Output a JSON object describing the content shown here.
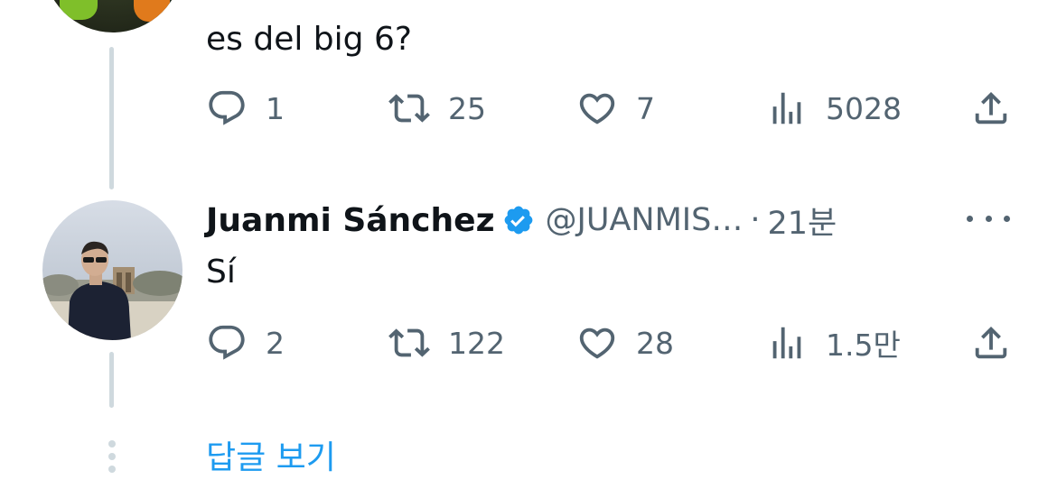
{
  "colors": {
    "text_primary": "#0f1419",
    "text_secondary": "#536471",
    "link": "#1d9bf0",
    "thread_line": "#cfd9de",
    "verified_badge": "#1d9bf0"
  },
  "tweets": [
    {
      "text": "es del big 6?",
      "actions": {
        "reply_count": "1",
        "retweet_count": "25",
        "like_count": "7",
        "view_count": "5028"
      }
    },
    {
      "display_name": "Juanmi Sánchez",
      "verified": true,
      "handle": "@JUANMIS…",
      "separator": "·",
      "time": "21분",
      "text": "Sí",
      "actions": {
        "reply_count": "2",
        "retweet_count": "122",
        "like_count": "28",
        "view_count": "1.5만"
      }
    }
  ],
  "icons": {
    "reply": "reply-icon",
    "retweet": "retweet-icon",
    "like": "heart-icon",
    "views": "views-icon",
    "share": "share-icon",
    "more": "more-options-icon",
    "verified": "verified-badge-icon"
  },
  "show_replies_label": "답글 보기"
}
